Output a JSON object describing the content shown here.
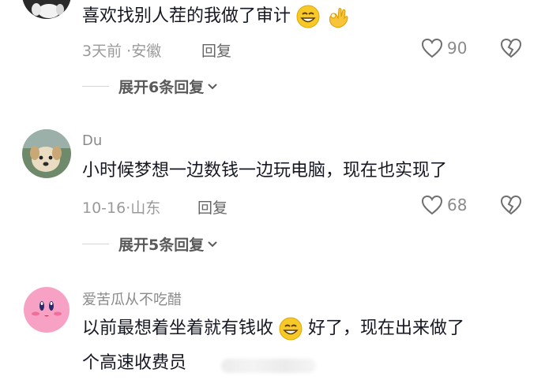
{
  "comments": [
    {
      "text_before": "喜欢找别人茬的我做了审计",
      "emojis": [
        "grin-emoji",
        "ok-hand-emoji"
      ],
      "time": "3天前",
      "location": "安徽",
      "reply_label": "回复",
      "likes": "90",
      "expand_label": "展开6条回复"
    },
    {
      "username": "Du",
      "text": "小时候梦想一边数钱一边玩电脑，现在也实现了",
      "time": "10-16",
      "location": "山东",
      "reply_label": "回复",
      "likes": "68",
      "expand_label": "展开5条回复"
    },
    {
      "username": "爱苦瓜从不吃醋",
      "text_line1_before": "以前最想着坐着就有钱收",
      "text_line1_after": "好了，现在出来做了",
      "text_line2": "个高速收费员"
    }
  ],
  "separator": "·",
  "colors": {
    "text": "#161823",
    "meta": "#9a9a9a",
    "username": "#8a8a8a"
  }
}
